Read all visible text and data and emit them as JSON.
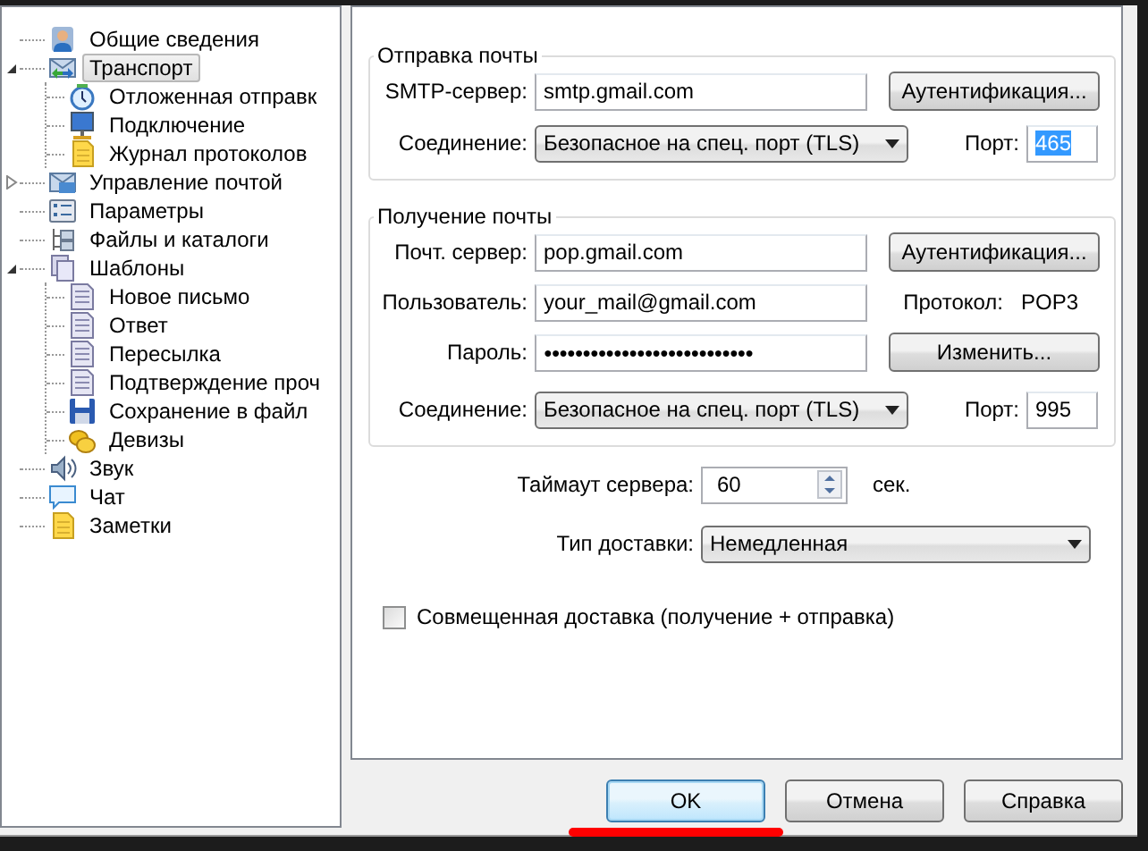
{
  "tree": [
    {
      "label": "Общие сведения",
      "selected": false
    },
    {
      "label": "Транспорт",
      "selected": true,
      "expanded": true,
      "children": [
        {
          "label": "Отложенная отправк",
          "selected": false
        },
        {
          "label": "Подключение",
          "selected": false
        },
        {
          "label": "Журнал протоколов",
          "selected": false
        }
      ]
    },
    {
      "label": "Управление почтой",
      "selected": false,
      "expanded": false
    },
    {
      "label": "Параметры",
      "selected": false
    },
    {
      "label": "Файлы и каталоги",
      "selected": false
    },
    {
      "label": "Шаблоны",
      "selected": false,
      "expanded": true,
      "children": [
        {
          "label": "Новое письмо",
          "selected": false
        },
        {
          "label": "Ответ",
          "selected": false
        },
        {
          "label": "Пересылка",
          "selected": false
        },
        {
          "label": "Подтверждение проч",
          "selected": false
        },
        {
          "label": "Сохранение в файл",
          "selected": false
        },
        {
          "label": "Девизы",
          "selected": false
        }
      ]
    },
    {
      "label": "Звук",
      "selected": false
    },
    {
      "label": "Чат",
      "selected": false
    },
    {
      "label": "Заметки",
      "selected": false
    }
  ],
  "sending": {
    "title": "Отправка почты",
    "server_label": "SMTP-сервер:",
    "server": "smtp.gmail.com",
    "auth_button": "Аутентификация...",
    "connection_label": "Соединение:",
    "connection": "Безопасное на спец. порт (TLS)",
    "port_label": "Порт:",
    "port": "465",
    "port_highlighted": true
  },
  "receiving": {
    "title": "Получение почты",
    "server_label": "Почт. сервер:",
    "server": "pop.gmail.com",
    "auth_button": "Аутентификация...",
    "user_label": "Пользователь:",
    "user": "your_mail@gmail.com",
    "protocol_label": "Протокол:",
    "protocol": "POP3",
    "password_label": "Пароль:",
    "password": "●●●●●●●●●●●●●●●●●●●●●●●●●●●",
    "change_button": "Изменить...",
    "connection_label": "Соединение:",
    "connection": "Безопасное на спец. порт (TLS)",
    "port_label": "Порт:",
    "port": "995",
    "port_highlighted": false
  },
  "timeout": {
    "label": "Таймаут сервера:",
    "value": "60",
    "unit": "сек."
  },
  "delivery": {
    "label": "Тип доставки:",
    "value": "Немедленная"
  },
  "combined": {
    "label": "Совмещенная доставка (получение + отправка)",
    "checked": false
  },
  "buttons": [
    {
      "label": "OK",
      "focused": true
    },
    {
      "label": "Отмена",
      "focused": false
    },
    {
      "label": "Справка",
      "focused": false
    }
  ]
}
